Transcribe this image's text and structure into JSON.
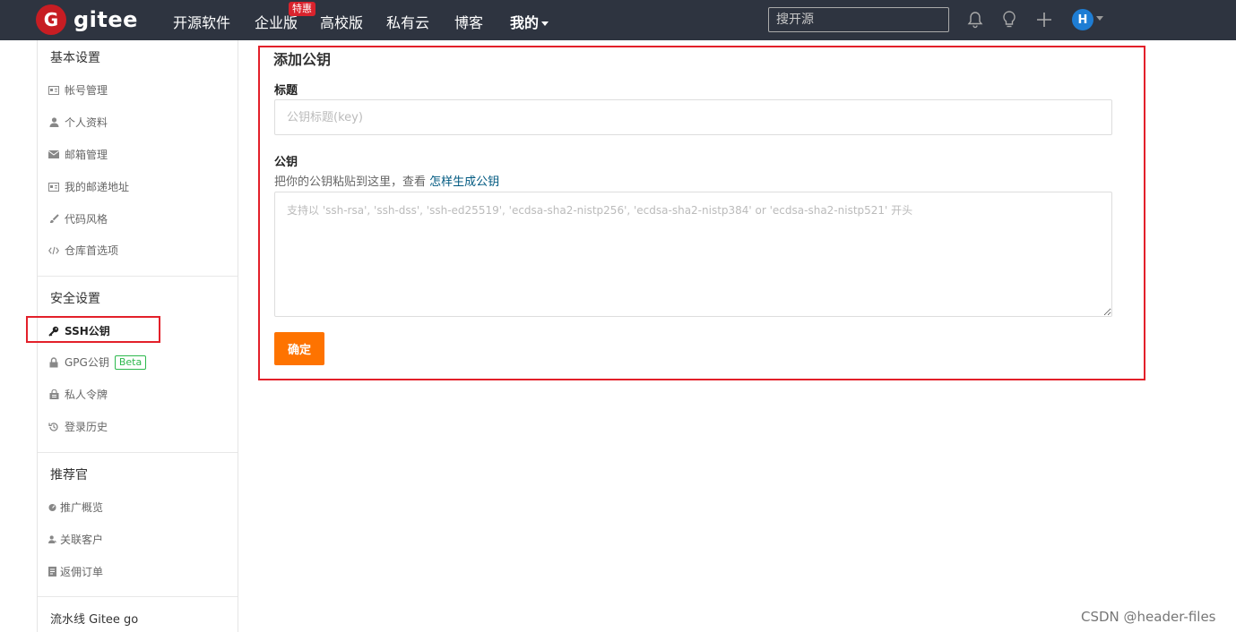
{
  "topbar": {
    "logo_letter": "G",
    "logo_text": "gitee",
    "nav": [
      "开源软件",
      "企业版",
      "高校版",
      "私有云",
      "博客",
      "我的"
    ],
    "hot_badge": "特惠",
    "search_placeholder": "搜开源",
    "avatar_letter": "H",
    "icons": [
      "bell-icon",
      "lightbulb-icon",
      "plus-icon"
    ],
    "colors": {
      "bar_bg": "#2e3440",
      "avatar_bg": "#1e7dd4",
      "logo_red": "#c71d23"
    }
  },
  "sidebar": {
    "sections": [
      {
        "title": "基本设置",
        "items": [
          {
            "label": "帐号管理",
            "icon": "id-card-icon"
          },
          {
            "label": "个人资料",
            "icon": "user-icon"
          },
          {
            "label": "邮箱管理",
            "icon": "envelope-icon"
          },
          {
            "label": "我的邮递地址",
            "icon": "address-card-icon"
          },
          {
            "label": "代码风格",
            "icon": "paintbrush-icon"
          },
          {
            "label": "仓库首选项",
            "icon": "code-icon"
          }
        ]
      },
      {
        "title": "安全设置",
        "items": [
          {
            "label": "SSH公钥",
            "icon": "key-icon",
            "active": true
          },
          {
            "label": "GPG公钥",
            "icon": "lock-icon",
            "badge": "Beta"
          },
          {
            "label": "私人令牌",
            "icon": "token-icon"
          },
          {
            "label": "登录历史",
            "icon": "history-icon"
          }
        ]
      },
      {
        "title": "推荐官",
        "items": [
          {
            "label": "推广概览",
            "icon": "gauge-icon"
          },
          {
            "label": "关联客户",
            "icon": "user-link-icon"
          },
          {
            "label": "返佣订单",
            "icon": "order-icon"
          }
        ]
      },
      {
        "title": "流水线 Gitee go",
        "items": []
      }
    ]
  },
  "form": {
    "title": "添加公钥",
    "title_label": "标题",
    "title_placeholder": "公钥标题(key)",
    "key_label": "公钥",
    "help_text": "把你的公钥粘贴到这里，查看 ",
    "help_link": "怎样生成公钥",
    "key_placeholder": "支持以 'ssh-rsa', 'ssh-dss', 'ssh-ed25519', 'ecdsa-sha2-nistp256', 'ecdsa-sha2-nistp384' or 'ecdsa-sha2-nistp521' 开头",
    "submit_label": "确定",
    "colors": {
      "submit_bg": "#fe7300",
      "highlight_box": "#e3202a",
      "link": "#005980"
    }
  },
  "watermark": "CSDN @header-files"
}
